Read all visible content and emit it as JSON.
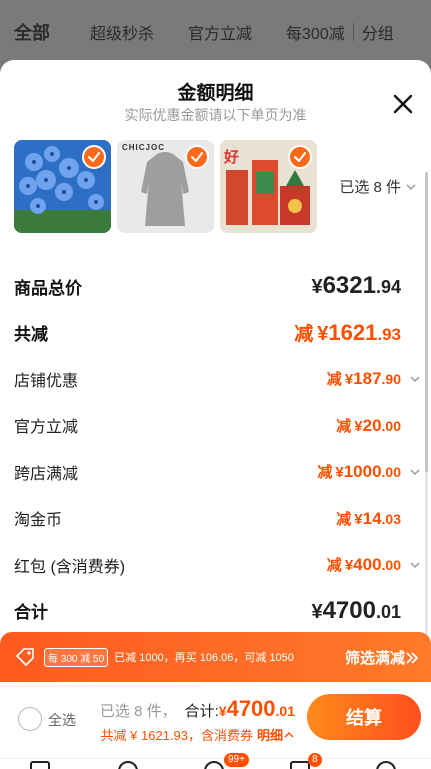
{
  "bg_tabs": {
    "items": [
      "全部",
      "超级秒杀",
      "官方立减",
      "每300减",
      "分组"
    ]
  },
  "sheet": {
    "title": "金额明细",
    "subtitle": "实际优惠金额请以下单页为准"
  },
  "products": {
    "brand_text": "CHICJOC",
    "gift_text": "好",
    "selected_count": "已选 8 件"
  },
  "rows": [
    {
      "label": "商品总价",
      "prefix": "",
      "currency": "¥",
      "int": "6321",
      "dec": ".94",
      "expandable": false
    },
    {
      "label": "共减",
      "prefix": "减",
      "currency": "¥",
      "int": "1621",
      "dec": ".93",
      "expandable": false
    },
    {
      "label": "店铺优惠",
      "prefix": "减",
      "currency": "¥",
      "int": "187",
      "dec": ".90",
      "expandable": true
    },
    {
      "label": "官方立减",
      "prefix": "减",
      "currency": "¥",
      "int": "20",
      "dec": ".00",
      "expandable": false
    },
    {
      "label": "跨店满减",
      "prefix": "减",
      "currency": "¥",
      "int": "1000",
      "dec": ".00",
      "expandable": true
    },
    {
      "label": "淘金币",
      "prefix": "减",
      "currency": "¥",
      "int": "14",
      "dec": ".03",
      "expandable": false
    },
    {
      "label": "红包 (含消费券)",
      "prefix": "减",
      "currency": "¥",
      "int": "400",
      "dec": ".00",
      "expandable": true
    },
    {
      "label": "合计",
      "prefix": "",
      "currency": "¥",
      "int": "4700",
      "dec": ".01",
      "expandable": false
    }
  ],
  "promo": {
    "badge": "每 300 减 50",
    "desc": "已减 1000，再买 106.06，可减 1050",
    "action": "筛选满减"
  },
  "footer": {
    "select_all": "全选",
    "selected": "已选 8 件，",
    "sum_label": "合计:",
    "currency": "¥",
    "int": "4700",
    "dec": ".01",
    "discount_text": "共减 ¥ 1621.93，含消费券",
    "detail": "明细",
    "checkout": "结算"
  },
  "nav": {
    "badge_messages": "99+",
    "badge_cart": "8"
  },
  "colors": {
    "accent": "#ff4f00",
    "checkout_gradient_start": "#ff8a1a",
    "checkout_gradient_end": "#ff4e1f"
  }
}
